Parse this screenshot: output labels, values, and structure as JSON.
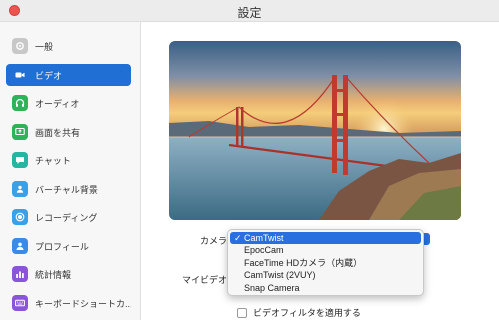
{
  "window": {
    "title": "設定"
  },
  "sidebar": {
    "items": [
      {
        "label": "一般",
        "icon": "gear-icon",
        "color": "#c8c8c8"
      },
      {
        "label": "ビデオ",
        "icon": "video-camera-icon",
        "color": "#1f6fd4",
        "selected": true
      },
      {
        "label": "オーディオ",
        "icon": "headphones-icon",
        "color": "#2fb35a"
      },
      {
        "label": "画面を共有",
        "icon": "share-screen-icon",
        "color": "#2fb35a"
      },
      {
        "label": "チャット",
        "icon": "chat-bubble-icon",
        "color": "#26b5a0"
      },
      {
        "label": "バーチャル背景",
        "icon": "person-icon",
        "color": "#3aa0e8"
      },
      {
        "label": "レコーディング",
        "icon": "record-icon",
        "color": "#3aa0e8"
      },
      {
        "label": "プロフィール",
        "icon": "profile-icon",
        "color": "#3a8ae8"
      },
      {
        "label": "統計情報",
        "icon": "bar-chart-icon",
        "color": "#8a55d8"
      },
      {
        "label": "キーボードショートカ...",
        "icon": "keyboard-icon",
        "color": "#8a55d8"
      }
    ]
  },
  "video": {
    "camera_label": "カメラ：",
    "my_video_label": "マイビデオ：",
    "options": [
      {
        "label": "ビデオフィルタを適用する",
        "checked": false
      }
    ],
    "camera_dropdown": {
      "options": [
        {
          "label": "CamTwist",
          "selected": true
        },
        {
          "label": "EpocCam",
          "selected": false
        },
        {
          "label": "FaceTime HDカメラ（内蔵）",
          "selected": false
        },
        {
          "label": "CamTwist (2VUY)",
          "selected": false
        },
        {
          "label": "Snap Camera",
          "selected": false
        }
      ],
      "check_mark": "✓"
    }
  },
  "colors": {
    "accent": "#1f6fd4",
    "selection": "#2a6fe0",
    "close_button": "#ef5350"
  }
}
